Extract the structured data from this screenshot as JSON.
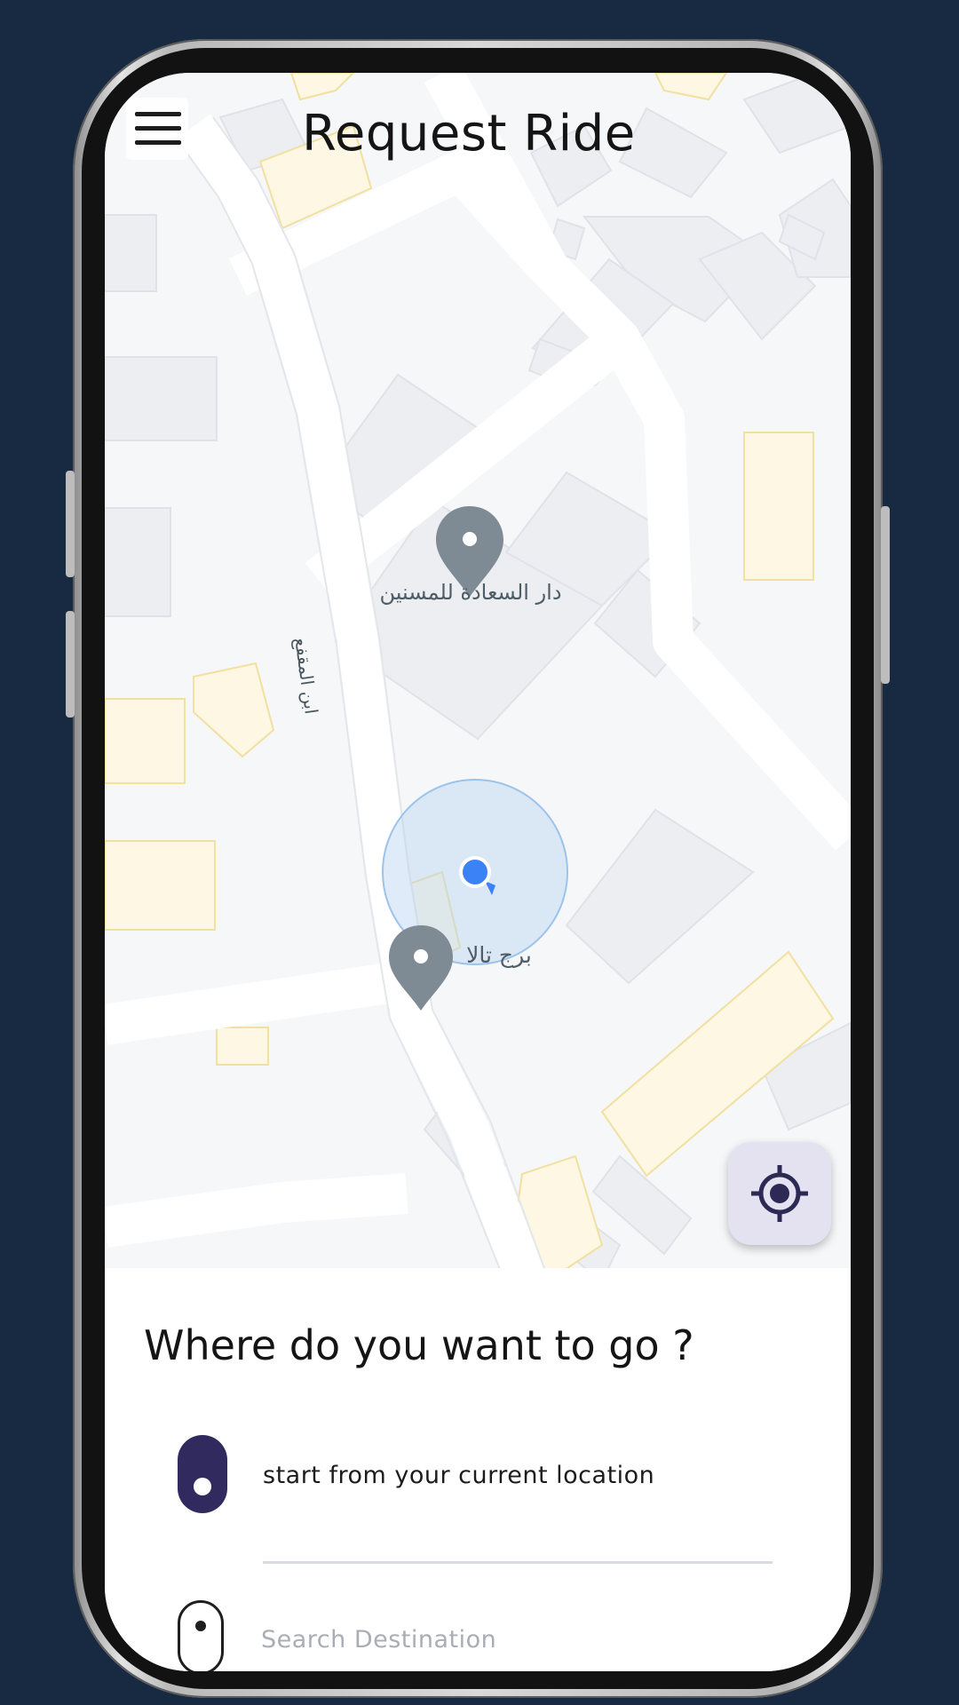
{
  "header": {
    "title": "Request Ride"
  },
  "map": {
    "labels": {
      "street": "ابن المقفع",
      "place_1": "دار السعادة للمسنين",
      "place_2": "برج تالا"
    },
    "user_marker_color": "#3b82f6",
    "accuracy_circle_color": "#b7d3ef"
  },
  "locate_button": {
    "icon": "my-location-icon"
  },
  "sheet": {
    "title": "Where do you want to go ?",
    "start_label": "start from your current location",
    "destination_placeholder": "Search Destination",
    "destination_value": ""
  },
  "colors": {
    "background": "#182a42",
    "accent": "#302a5e",
    "locate_bg": "#e4e2f0"
  }
}
